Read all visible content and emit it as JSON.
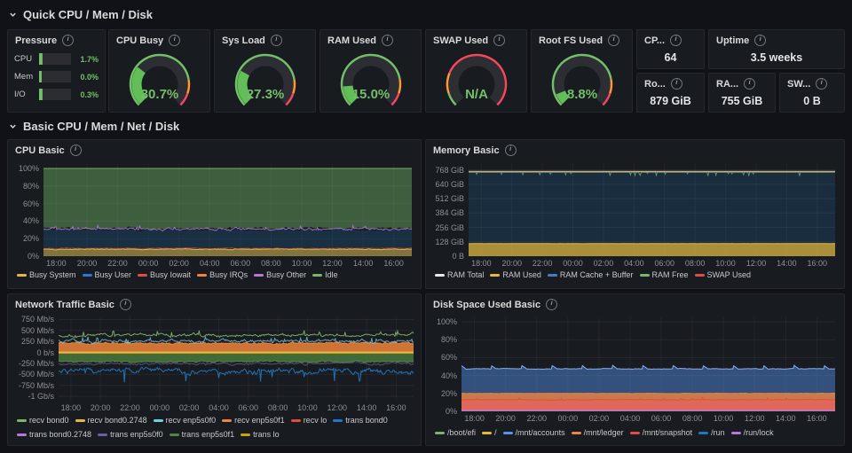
{
  "sections": [
    {
      "title": "Quick CPU / Mem / Disk"
    },
    {
      "title": "Basic CPU / Mem / Net / Disk"
    }
  ],
  "pressure": {
    "title": "Pressure",
    "rows": [
      {
        "label": "CPU",
        "value": "1.7%",
        "percent": 1.7
      },
      {
        "label": "Mem",
        "value": "0.0%",
        "percent": 0.0
      },
      {
        "label": "I/O",
        "value": "0.3%",
        "percent": 0.3
      }
    ]
  },
  "gauges": [
    {
      "title": "CPU Busy",
      "value": "30.7%",
      "percent": 30.7,
      "thresholds": [
        {
          "to": 80,
          "color": "#73BF69"
        },
        {
          "to": 90,
          "color": "#FF9830"
        },
        {
          "to": 100,
          "color": "#F2495C"
        }
      ]
    },
    {
      "title": "Sys Load",
      "value": "27.3%",
      "percent": 27.3,
      "thresholds": [
        {
          "to": 80,
          "color": "#73BF69"
        },
        {
          "to": 90,
          "color": "#FF9830"
        },
        {
          "to": 100,
          "color": "#F2495C"
        }
      ]
    },
    {
      "title": "RAM Used",
      "value": "15.0%",
      "percent": 15.0,
      "thresholds": [
        {
          "to": 80,
          "color": "#73BF69"
        },
        {
          "to": 90,
          "color": "#FF9830"
        },
        {
          "to": 100,
          "color": "#F2495C"
        }
      ]
    },
    {
      "title": "SWAP Used",
      "value": "N/A",
      "percent": null,
      "thresholds": [
        {
          "to": 10,
          "color": "#73BF69"
        },
        {
          "to": 25,
          "color": "#FF9830"
        },
        {
          "to": 100,
          "color": "#F2495C"
        }
      ]
    },
    {
      "title": "Root FS Used",
      "value": "8.8%",
      "percent": 8.8,
      "thresholds": [
        {
          "to": 80,
          "color": "#73BF69"
        },
        {
          "to": 90,
          "color": "#FF9830"
        },
        {
          "to": 100,
          "color": "#F2495C"
        }
      ]
    }
  ],
  "stats": [
    {
      "title": "CP...",
      "value": "64"
    },
    {
      "title": "Uptime",
      "value": "3.5 weeks"
    },
    {
      "title": "Ro...",
      "value": "879 GiB"
    },
    {
      "title": "RA...",
      "value": "755 GiB"
    },
    {
      "title": "SW...",
      "value": "0 B"
    }
  ],
  "time_ticks": [
    "18:00",
    "20:00",
    "22:00",
    "00:00",
    "02:00",
    "04:00",
    "06:00",
    "08:00",
    "10:00",
    "12:00",
    "14:00",
    "16:00"
  ],
  "colors": {
    "page_bg": "#111217",
    "panel_bg": "#181b1f",
    "border": "#25272e",
    "value_green": "#73BF69"
  },
  "chart_data": [
    {
      "id": "cpu-basic",
      "type": "area",
      "title": "CPU Basic",
      "units": "%",
      "ylim": [
        0,
        105
      ],
      "yticks": [
        {
          "v": 0,
          "label": "0%"
        },
        {
          "v": 20,
          "label": "20%"
        },
        {
          "v": 40,
          "label": "40%"
        },
        {
          "v": 60,
          "label": "60%"
        },
        {
          "v": 80,
          "label": "80%"
        },
        {
          "v": 100,
          "label": "100%"
        }
      ],
      "x_ticks": [
        "18:00",
        "20:00",
        "22:00",
        "00:00",
        "02:00",
        "04:00",
        "06:00",
        "08:00",
        "10:00",
        "12:00",
        "14:00",
        "16:00"
      ],
      "legend": [
        {
          "label": "Busy System",
          "color": "#EAB839"
        },
        {
          "label": "Busy User",
          "color": "#3274D9"
        },
        {
          "label": "Busy Iowait",
          "color": "#E24D42"
        },
        {
          "label": "Busy IRQs",
          "color": "#EF843C"
        },
        {
          "label": "Busy Other",
          "color": "#B877D9"
        },
        {
          "label": "Idle",
          "color": "#7EB26D"
        }
      ],
      "wrap_at": 6,
      "series": [
        {
          "name": "Busy User",
          "approx": "stacked band 8-30%",
          "mode": "area",
          "base": 30,
          "amp": 2.6,
          "fill_to": 0,
          "fill": "#1F78C1",
          "fill_opacity": 0.22,
          "width": 0,
          "seed": 3
        },
        {
          "name": "Busy System",
          "approx": "band 0-8%",
          "mode": "area",
          "base": 8,
          "amp": 1.1,
          "fill_to": 0,
          "fill": "#EAB839",
          "fill_opacity": 0.5,
          "line_color": "#EAB839",
          "width": 1,
          "seed": 4
        },
        {
          "name": "Busy Iowait",
          "approx": "~9% noisy line",
          "mode": "line",
          "base": 9,
          "amp": 0.9,
          "color": "#E24D42",
          "width": 0.8,
          "opacity": 0.7,
          "seed": 7
        },
        {
          "name": "Idle",
          "approx": "~30-100%, about 70% idle",
          "mode": "area",
          "base": 32,
          "amp": 2.8,
          "fill_to": 100,
          "cap": 100,
          "fill": "#73BF69",
          "fill_opacity": 0.42,
          "line_color": "#73BF69",
          "width": 0,
          "seed": 5
        },
        {
          "name": "Busy Other",
          "approx": "~31% noisy line",
          "mode": "line",
          "base": 31,
          "amp": 3,
          "color": "#B877D9",
          "width": 1,
          "opacity": 0.85,
          "seed": 6,
          "spike_prob": 0.04,
          "spike_amp": 4
        }
      ]
    },
    {
      "id": "memory-basic",
      "type": "area",
      "title": "Memory Basic",
      "units": "GiB",
      "ylim": [
        0,
        820
      ],
      "yticks": [
        {
          "v": 0,
          "label": "0 B"
        },
        {
          "v": 128,
          "label": "128 GiB"
        },
        {
          "v": 256,
          "label": "256 GiB"
        },
        {
          "v": 384,
          "label": "384 GiB"
        },
        {
          "v": 512,
          "label": "512 GiB"
        },
        {
          "v": 640,
          "label": "640 GiB"
        },
        {
          "v": 768,
          "label": "768 GiB"
        }
      ],
      "x_ticks": [
        "18:00",
        "20:00",
        "22:00",
        "00:00",
        "02:00",
        "04:00",
        "06:00",
        "08:00",
        "10:00",
        "12:00",
        "14:00",
        "16:00"
      ],
      "legend": [
        {
          "label": "RAM Total",
          "color": "#E8E8EC"
        },
        {
          "label": "RAM Used",
          "color": "#EAB839"
        },
        {
          "label": "RAM Cache + Buffer",
          "color": "#447EBC"
        },
        {
          "label": "RAM Free",
          "color": "#7EB26D"
        },
        {
          "label": "SWAP Used",
          "color": "#E24D42"
        }
      ],
      "wrap_at": 5,
      "series": [
        {
          "name": "RAM Cache + Buffer",
          "approx": "fill up to ~750 GiB",
          "mode": "area",
          "base": 750,
          "amp": 1.5,
          "fill_to": 0,
          "fill": "#1F78C1",
          "fill_opacity": 0.2,
          "width": 0,
          "seed": 8
        },
        {
          "name": "RAM Free",
          "approx": "~640 GiB free, downward spikes at top",
          "mode": "spikes",
          "base": 747,
          "amp": 1.2,
          "spike_prob": 0.045,
          "spike_amp": -35,
          "color": "#7EB26D",
          "width": 1,
          "opacity": 0.75,
          "seed": 9
        },
        {
          "name": "RAM Total",
          "approx": "755 GiB flat line",
          "mode": "flat",
          "base": 753,
          "color": "#C4AD8B",
          "width": 1.5,
          "seed": 10
        },
        {
          "name": "RAM Used",
          "approx": "~112 GiB (15%)",
          "mode": "area",
          "base": 112,
          "amp": 2,
          "fill_to": 0,
          "fill": "#EAB839",
          "fill_opacity": 0.7,
          "line_color": "#EAB839",
          "width": 1,
          "seed": 11
        }
      ]
    },
    {
      "id": "network-traffic-basic",
      "type": "line",
      "title": "Network Traffic Basic",
      "units": "Mb/s",
      "ylim": [
        -1100,
        800
      ],
      "yticks": [
        {
          "v": -1000,
          "label": "-1 Gb/s"
        },
        {
          "v": -750,
          "label": "-750 Mb/s"
        },
        {
          "v": -500,
          "label": "-500 Mb/s"
        },
        {
          "v": -250,
          "label": "-250 Mb/s"
        },
        {
          "v": 0,
          "label": "0 b/s"
        },
        {
          "v": 250,
          "label": "250 Mb/s"
        },
        {
          "v": 500,
          "label": "500 Mb/s"
        },
        {
          "v": 750,
          "label": "750 Mb/s"
        }
      ],
      "x_ticks": [
        "18:00",
        "20:00",
        "22:00",
        "00:00",
        "02:00",
        "04:00",
        "06:00",
        "08:00",
        "10:00",
        "12:00",
        "14:00",
        "16:00"
      ],
      "legend": [
        {
          "label": "recv bond0",
          "color": "#7EB26D"
        },
        {
          "label": "recv bond0.2748",
          "color": "#EAB839"
        },
        {
          "label": "recv enp5s0f0",
          "color": "#6ED0E0"
        },
        {
          "label": "recv enp5s0f1",
          "color": "#EF843C"
        },
        {
          "label": "recv lo",
          "color": "#E24D42"
        },
        {
          "label": "trans bond0",
          "color": "#1F78C1"
        },
        {
          "label": "trans bond0.2748",
          "color": "#B877D9"
        },
        {
          "label": "trans enp5s0f0",
          "color": "#705DA0"
        },
        {
          "label": "trans enp5s0f1",
          "color": "#508642"
        },
        {
          "label": "trans lo",
          "color": "#CCA300"
        }
      ],
      "wrap_at": 6,
      "series": [
        {
          "name": "recv enp5s0f1",
          "approx": "+200 Mb/s area",
          "mode": "area",
          "base": 210,
          "amp": 50,
          "fill_to": 0,
          "fill": "#EF843C",
          "fill_opacity": 0.85,
          "line_color": "#EF843C",
          "width": 1,
          "seed": 12
        },
        {
          "name": "recv enp5s0f0",
          "approx": "+250 Mb/s noisy",
          "mode": "line",
          "base": 255,
          "amp": 85,
          "color": "#6ED0E0",
          "width": 1,
          "opacity": 0.8,
          "seed": 13,
          "spike_prob": 0.05,
          "spike_amp": 110
        },
        {
          "name": "recv bond0",
          "approx": "+350..500 Mb/s noisy",
          "mode": "line",
          "base": 390,
          "amp": 75,
          "color": "#7EB26D",
          "width": 1,
          "opacity": 0.95,
          "seed": 14,
          "spike_prob": 0.05,
          "spike_amp": 100
        },
        {
          "name": "trans enp5s0f1",
          "approx": "-200 Mb/s area",
          "mode": "area",
          "base": -210,
          "amp": 40,
          "fill_to": 0,
          "fill": "#508642",
          "fill_opacity": 0.75,
          "line_color": "#508642",
          "width": 1,
          "seed": 15
        },
        {
          "name": "trans bond0.2748",
          "approx": "-250 Mb/s noisy",
          "mode": "line",
          "base": -255,
          "amp": 65,
          "color": "#705DA0",
          "width": 1,
          "opacity": 0.7,
          "seed": 16
        },
        {
          "name": "trans bond0",
          "approx": "-400..-800 Mb/s noisy",
          "mode": "line",
          "base": -430,
          "amp": 140,
          "color": "#1F78C1",
          "width": 1,
          "opacity": 0.95,
          "seed": 17,
          "spike_prob": 0.035,
          "spike_amp": -280
        },
        {
          "name": "recv bond0.2748 + trans lo",
          "approx": "~0 b/s flat",
          "mode": "flat",
          "base": 0,
          "color": "#EAB839",
          "width": 2.2,
          "seed": 18
        }
      ]
    },
    {
      "id": "disk-space-used-basic",
      "type": "area",
      "title": "Disk Space Used Basic",
      "units": "%",
      "ylim": [
        0,
        105
      ],
      "yticks": [
        {
          "v": 0,
          "label": "0%"
        },
        {
          "v": 20,
          "label": "20%"
        },
        {
          "v": 40,
          "label": "40%"
        },
        {
          "v": 60,
          "label": "60%"
        },
        {
          "v": 80,
          "label": "80%"
        },
        {
          "v": 100,
          "label": "100%"
        }
      ],
      "x_ticks": [
        "18:00",
        "20:00",
        "22:00",
        "00:00",
        "02:00",
        "04:00",
        "06:00",
        "08:00",
        "10:00",
        "12:00",
        "14:00",
        "16:00"
      ],
      "legend": [
        {
          "label": "/boot/efi",
          "color": "#7EB26D"
        },
        {
          "label": "/",
          "color": "#EAB839"
        },
        {
          "label": "/mnt/accounts",
          "color": "#5794F2"
        },
        {
          "label": "/mnt/ledger",
          "color": "#EF843C"
        },
        {
          "label": "/mnt/snapshot",
          "color": "#E24D42"
        },
        {
          "label": "/run",
          "color": "#1F78C1"
        },
        {
          "label": "/run/lock",
          "color": "#B877D9"
        }
      ],
      "wrap_at": 7,
      "series": [
        {
          "name": "/mnt/accounts",
          "approx": "~48% with periodic spikes to ~52%",
          "mode": "area",
          "base": 47.5,
          "amp": 0.8,
          "fill_to": 0,
          "fill": "#5794F2",
          "fill_opacity": 0.45,
          "line_color": "#86AEF0",
          "width": 1,
          "seed": 19,
          "bumps": {
            "period": 34,
            "width": 5,
            "amp": 3.5
          }
        },
        {
          "name": "/mnt/ledger",
          "approx": "~20%",
          "mode": "area",
          "base": 20,
          "amp": 0.5,
          "fill_to": 0,
          "fill": "#EF843C",
          "fill_opacity": 0.8,
          "line_color": "#EF843C",
          "width": 1,
          "seed": 20
        },
        {
          "name": "/mnt/snapshot",
          "approx": "~13%",
          "mode": "area",
          "base": 13,
          "amp": 0.8,
          "fill_to": 0,
          "fill": "#E0675C",
          "fill_opacity": 0.95,
          "line_color": "#E24D42",
          "width": 1,
          "seed": 21,
          "spike_prob": 0.02,
          "spike_amp": 2
        },
        {
          "name": "/run/lock",
          "approx": "~1%",
          "mode": "flat",
          "base": 1,
          "color": "#B877D9",
          "width": 1.4,
          "seed": 22
        }
      ]
    }
  ]
}
